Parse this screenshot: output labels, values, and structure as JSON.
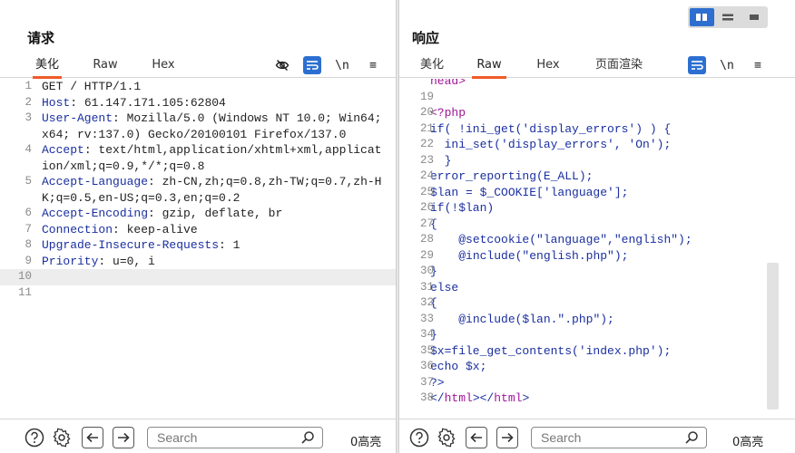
{
  "request": {
    "title": "请求",
    "tabs": [
      "美化",
      "Raw",
      "Hex"
    ],
    "tools": {
      "newline": "\\n",
      "menu": "≡"
    },
    "lines": [
      {
        "n": "1",
        "parts": [
          {
            "t": "GET / HTTP/1.1",
            "c": ""
          }
        ]
      },
      {
        "n": "2",
        "parts": [
          {
            "t": "Host",
            "c": "k"
          },
          {
            "t": ": 61.147.171.105:62804",
            "c": ""
          }
        ]
      },
      {
        "n": "3",
        "parts": [
          {
            "t": "User-Agent",
            "c": "k"
          },
          {
            "t": ": Mozilla/5.0 (Windows NT 10.0; Win64; x64; rv:137.0) Gecko/20100101 Firefox/137.0",
            "c": ""
          }
        ]
      },
      {
        "n": "4",
        "parts": [
          {
            "t": "Accept",
            "c": "k"
          },
          {
            "t": ": text/html,application/xhtml+xml,application/xml;q=0.9,*/*;q=0.8",
            "c": ""
          }
        ]
      },
      {
        "n": "5",
        "parts": [
          {
            "t": "Accept-Language",
            "c": "k"
          },
          {
            "t": ": zh-CN,zh;q=0.8,zh-TW;q=0.7,zh-HK;q=0.5,en-US;q=0.3,en;q=0.2",
            "c": ""
          }
        ]
      },
      {
        "n": "6",
        "parts": [
          {
            "t": "Accept-Encoding",
            "c": "k"
          },
          {
            "t": ": gzip, deflate, br",
            "c": ""
          }
        ]
      },
      {
        "n": "7",
        "parts": [
          {
            "t": "Connection",
            "c": "k"
          },
          {
            "t": ": keep-alive",
            "c": ""
          }
        ]
      },
      {
        "n": "8",
        "parts": [
          {
            "t": "Upgrade-Insecure-Requests",
            "c": "k"
          },
          {
            "t": ": 1",
            "c": ""
          }
        ]
      },
      {
        "n": "9",
        "parts": [
          {
            "t": "Priority",
            "c": "k"
          },
          {
            "t": ": u=0, i",
            "c": ""
          }
        ]
      },
      {
        "n": "10",
        "parts": [
          {
            "t": "",
            "c": ""
          }
        ],
        "cursor": true
      },
      {
        "n": "11",
        "parts": [
          {
            "t": "",
            "c": ""
          }
        ]
      }
    ],
    "search_placeholder": "Search",
    "highlight_count": "0高亮"
  },
  "response": {
    "title": "响应",
    "tabs": [
      "美化",
      "Raw",
      "Hex",
      "页面渲染"
    ],
    "tools": {
      "newline": "\\n",
      "menu": "≡"
    },
    "top_partial": "head>",
    "lines": [
      {
        "n": "19",
        "parts": [
          {
            "t": "",
            "c": ""
          }
        ]
      },
      {
        "n": "20",
        "parts": [
          {
            "t": "<?php",
            "c": "t"
          }
        ]
      },
      {
        "n": "21",
        "parts": [
          {
            "t": "if( !ini_get('display_errors') ) {",
            "c": "k"
          }
        ]
      },
      {
        "n": "22",
        "parts": [
          {
            "t": "  ini_set('display_errors', 'On');",
            "c": "k"
          }
        ]
      },
      {
        "n": "23",
        "parts": [
          {
            "t": "  }",
            "c": "k"
          }
        ]
      },
      {
        "n": "24",
        "parts": [
          {
            "t": "error_reporting(E_ALL);",
            "c": "k"
          }
        ]
      },
      {
        "n": "25",
        "parts": [
          {
            "t": "$lan = $_COOKIE['language'];",
            "c": "k"
          }
        ]
      },
      {
        "n": "26",
        "parts": [
          {
            "t": "if(!$lan)",
            "c": "k"
          }
        ]
      },
      {
        "n": "27",
        "parts": [
          {
            "t": "{",
            "c": "k"
          }
        ]
      },
      {
        "n": "28",
        "parts": [
          {
            "t": "    @setcookie(\"language\",\"english\");",
            "c": "k"
          }
        ]
      },
      {
        "n": "29",
        "parts": [
          {
            "t": "    @include(\"english.php\");",
            "c": "k"
          }
        ]
      },
      {
        "n": "30",
        "parts": [
          {
            "t": "}",
            "c": "k"
          }
        ]
      },
      {
        "n": "31",
        "parts": [
          {
            "t": "else",
            "c": "k"
          }
        ]
      },
      {
        "n": "32",
        "parts": [
          {
            "t": "{",
            "c": "k"
          }
        ]
      },
      {
        "n": "33",
        "parts": [
          {
            "t": "    @include($lan.\".php\");",
            "c": "k"
          }
        ]
      },
      {
        "n": "34",
        "parts": [
          {
            "t": "}",
            "c": "k"
          }
        ]
      },
      {
        "n": "35",
        "parts": [
          {
            "t": "$x=file_get_contents('index.php');",
            "c": "k"
          }
        ]
      },
      {
        "n": "36",
        "parts": [
          {
            "t": "echo $x;",
            "c": "k"
          }
        ]
      },
      {
        "n": "37",
        "parts": [
          {
            "t": "?>",
            "c": "k"
          }
        ]
      },
      {
        "n": "38",
        "parts": [
          {
            "t": "</",
            "c": "k"
          },
          {
            "t": "html",
            "c": "t"
          },
          {
            "t": "></",
            "c": "k"
          },
          {
            "t": "html",
            "c": "t"
          },
          {
            "t": ">",
            "c": "k"
          }
        ]
      }
    ],
    "search_placeholder": "Search",
    "highlight_count": "0高亮"
  },
  "colors": {
    "accent": "#2c6fd0",
    "tab_underline": "#f05a28",
    "keyword": "#1a2fa0",
    "string": "#b02525",
    "tag": "#a0159a"
  }
}
